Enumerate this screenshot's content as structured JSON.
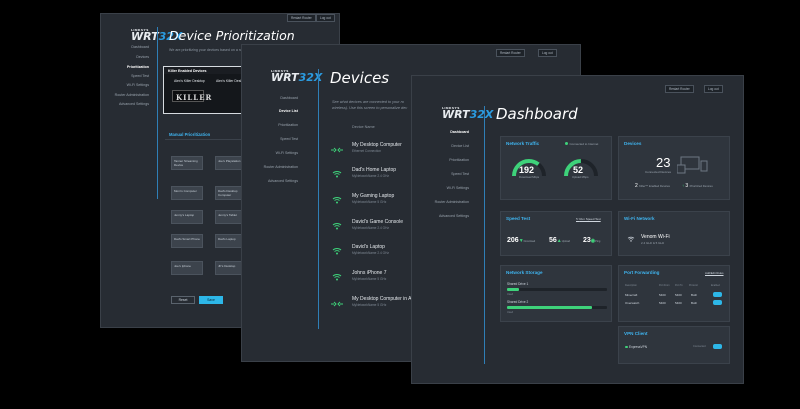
{
  "prioritization": {
    "title": "Device Prioritization",
    "logo": {
      "brand": "LINKSYS",
      "model_a": "WRT",
      "model_b": "32X"
    },
    "top_buttons": [
      "Restart Router",
      "Log out"
    ],
    "nav": [
      "Dashboard",
      "Devices",
      "Prioritization",
      "Speed Test",
      "Wi-Fi Settings",
      "Router Administration",
      "Advanced Settings"
    ],
    "intro": "We are prioritizing your devices based on a ranki",
    "killer_header": "Killer Enabled Devices",
    "killer_items": [
      "Alex's Killer Desktop",
      "Alex's Killer Deskt"
    ],
    "manual_header": "Manual Prioritization",
    "prio_left": [
      "Tanner Streaming Device",
      "Mom's Computer",
      "Jenny's Laptop",
      "Dad's Smart Phone",
      "Joe's Iphone"
    ],
    "prio_right": [
      "Joe's Playstation",
      "Dad's Desktop Computer",
      "Jenny's Tablet",
      "Dad's Laptop",
      "JF's Desktop"
    ],
    "reset_label": "Reset",
    "save_label": "Save"
  },
  "devices": {
    "title": "Devices",
    "logo": {
      "brand": "LINKSYS",
      "model_a": "WRT",
      "model_b": "32X"
    },
    "top_buttons": [
      "Restart Router",
      "Log out"
    ],
    "nav": [
      "Dashboard",
      "Device List",
      "Prioritization",
      "Speed Test",
      "Wi-Fi Settings",
      "Router Administration",
      "Advanced Settings"
    ],
    "intro_line1": "See what devices are connected to your ro",
    "intro_line2": "wireless). Use this screen to personalize dev",
    "column_header": "Device Name",
    "items": [
      {
        "name": "My Desktop Computer",
        "sub": "Ethernet Connection",
        "icon": "ethernet-icon"
      },
      {
        "name": "Dad's Home Laptop",
        "sub": "MyNetworkName 2.4 GHz",
        "icon": "wifi-icon"
      },
      {
        "name": "My Gaming Laptop",
        "sub": "MyNetworkName 5 GHz",
        "icon": "wifi-icon"
      },
      {
        "name": "David's Game Console",
        "sub": "MyNetworkName 2.4 GHz",
        "icon": "wifi-icon"
      },
      {
        "name": "David's Laptop",
        "sub": "MyNetworkName 2.4 GHz",
        "icon": "wifi-icon"
      },
      {
        "name": "Johns iPhone 7",
        "sub": "MyNetworkName 5 GHz",
        "icon": "wifi-icon"
      },
      {
        "name": "My Desktop Computer in A",
        "sub": "MyNetworkName 5 GHz",
        "icon": "ethernet-icon"
      }
    ]
  },
  "dashboard": {
    "title": "Dashboard",
    "logo": {
      "brand": "LINKSYS",
      "model_a": "WRT",
      "model_b": "32X"
    },
    "top_buttons": [
      "Restart Router",
      "Log out"
    ],
    "nav": [
      "Dashboard",
      "Device List",
      "Prioritization",
      "Speed Test",
      "Wi-Fi Settings",
      "Router Administration",
      "Advanced Settings"
    ],
    "network_traffic": {
      "title": "Network Traffic",
      "status": "Connected to Internet",
      "download_value": "192",
      "download_unit": "Mbps",
      "download_label": "Download",
      "upload_value": "52",
      "upload_unit": "Mbps",
      "upload_label": "Upload",
      "download_level": 0.72,
      "upload_level": 0.5
    },
    "devices_card": {
      "title": "Devices",
      "count": "23",
      "count_label": "Connected Devices",
      "killer_count": "2",
      "killer_label": "Killer™ Enabled Devices",
      "prio_count": "3",
      "prio_label": "Prioritized Devices"
    },
    "speed_test": {
      "title": "Speed Test",
      "run_label": "Run Speed Test",
      "download": "206",
      "download_label": "Download",
      "upload": "56",
      "upload_label": "Upload",
      "ping": "23",
      "ping_label": "Ping"
    },
    "wifi": {
      "title": "Wi-Fi Network",
      "name": "Venom Wi-Fi",
      "sub": "2.4 GHz & 5 GHz"
    },
    "storage": {
      "title": "Network Storage",
      "drives": [
        {
          "name": "Shared Drive 1",
          "used": "Used",
          "fraction": 0.12
        },
        {
          "name": "Shared Drive 2",
          "used": "Used",
          "fraction": 0.85
        }
      ]
    },
    "port_forwarding": {
      "title": "Port Forwarding",
      "add_label": "Add/Edit Rules",
      "headers": [
        "Description",
        "Port From",
        "Port To",
        "Protocol",
        "Enabled"
      ],
      "rows": [
        {
          "desc": "Minecraft",
          "from": "5400",
          "to": "5400",
          "proto": "Both"
        },
        {
          "desc": "Overwatch",
          "from": "5400",
          "to": "5400",
          "proto": "Both"
        }
      ]
    },
    "vpn": {
      "title": "VPN Client",
      "name": "ExpressVPN",
      "state": "Connected"
    }
  }
}
